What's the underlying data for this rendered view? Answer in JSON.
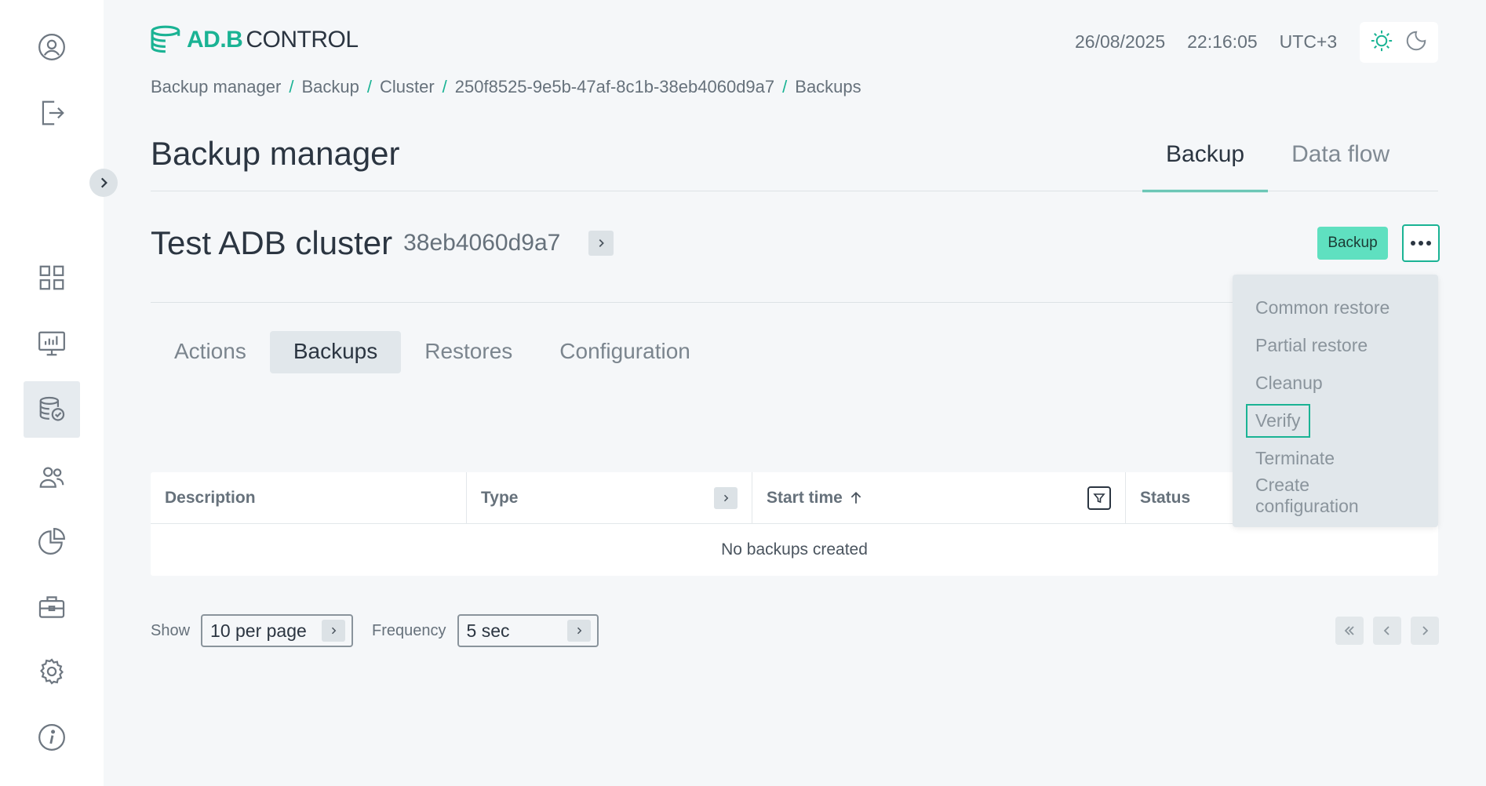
{
  "app": {
    "logo_text_adb": "AD.B",
    "logo_text_control": "CONTROL"
  },
  "header": {
    "date": "26/08/2025",
    "time": "22:16:05",
    "timezone": "UTC+3"
  },
  "breadcrumb": [
    "Backup manager",
    "Backup",
    "Cluster",
    "250f8525-9e5b-47af-8c1b-38eb4060d9a7",
    "Backups"
  ],
  "page": {
    "title": "Backup manager",
    "tabs": [
      {
        "label": "Backup",
        "active": true
      },
      {
        "label": "Data flow",
        "active": false
      }
    ]
  },
  "cluster": {
    "name": "Test ADB cluster",
    "id": "38eb4060d9a7",
    "backup_button": "Backup"
  },
  "sub_tabs": [
    {
      "label": "Actions",
      "active": false
    },
    {
      "label": "Backups",
      "active": true
    },
    {
      "label": "Restores",
      "active": false
    },
    {
      "label": "Configuration",
      "active": false
    }
  ],
  "table": {
    "columns": [
      "Description",
      "Type",
      "Start time",
      "Status"
    ],
    "empty_text": "No backups created"
  },
  "footer": {
    "show_label": "Show",
    "per_page": "10 per page",
    "frequency_label": "Frequency",
    "frequency": "5 sec"
  },
  "menu": {
    "items": [
      "Common restore",
      "Partial restore",
      "Cleanup",
      "Verify",
      "Terminate",
      "Create configuration"
    ],
    "highlighted": "Verify"
  },
  "colors": {
    "accent": "#1ab394",
    "backup_button": "#5fe0c0"
  }
}
